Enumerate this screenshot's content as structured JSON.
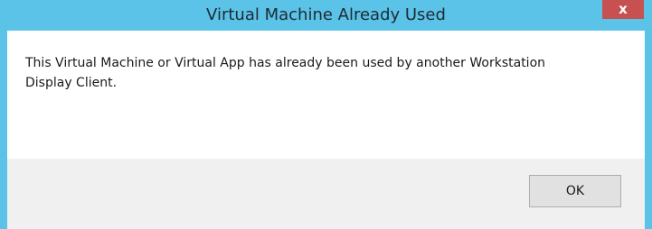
{
  "window": {
    "title": "Virtual Machine Already Used",
    "close_label": "x"
  },
  "dialog": {
    "message_line1": "This Virtual Machine or Virtual App has already been used by another Workstation",
    "message_line2": "Display Client."
  },
  "buttons": {
    "ok_label": "OK"
  },
  "colors": {
    "titlebar": "#5bc3e8",
    "close_button": "#c75050",
    "content_bg": "#ffffff",
    "footer_bg": "#f0f0f0"
  }
}
